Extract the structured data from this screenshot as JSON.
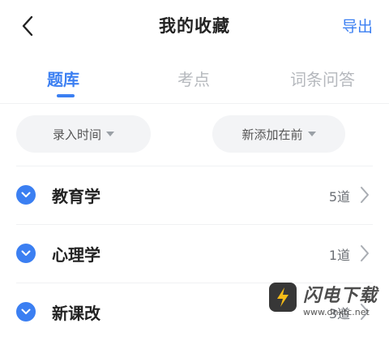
{
  "header": {
    "title": "我的收藏",
    "export_label": "导出",
    "back_icon": "chevron-left-icon"
  },
  "tabs": [
    {
      "label": "题库",
      "active": true
    },
    {
      "label": "考点",
      "active": false
    },
    {
      "label": "词条问答",
      "active": false
    }
  ],
  "filters": [
    {
      "label": "录入时间",
      "icon": "caret-down-icon"
    },
    {
      "label": "新添加在前",
      "icon": "caret-down-icon"
    }
  ],
  "categories": [
    {
      "label": "教育学",
      "count": "5道"
    },
    {
      "label": "心理学",
      "count": "1道"
    },
    {
      "label": "新课改",
      "count": "3道"
    }
  ],
  "watermark": {
    "title": "闪电下载",
    "url": "www.dnxtc.net"
  },
  "colors": {
    "accent": "#3b7ff2",
    "text": "#222222",
    "muted": "#b5b8bd",
    "pill_bg": "#f3f4f6"
  }
}
